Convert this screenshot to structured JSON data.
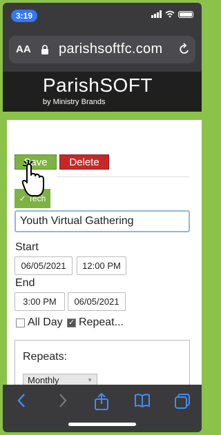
{
  "status_bar": {
    "time": "3:19"
  },
  "browser": {
    "text_size_label": "AA",
    "url": "parishsoftfc.com"
  },
  "logo": {
    "brand_name": "ParishSOFT",
    "tagline": "by Ministry Brands"
  },
  "form": {
    "save_label": "Save",
    "delete_label": "Delete",
    "tag_label": "Tech",
    "title_value": "Youth Virtual Gathering",
    "start_label": "Start",
    "start_date": "06/05/2021",
    "start_time": "12:00 PM",
    "end_label": "End",
    "end_time": "3:00 PM",
    "end_date": "06/05/2021",
    "all_day_label": "All Day",
    "repeat_label": "Repeat...",
    "repeats_label": "Repeats:",
    "repeats_value": "Monthly"
  },
  "colors": {
    "frame_green": "#8bc34a",
    "save_green": "#7cb342",
    "delete_red": "#c62828",
    "browser_bar": "#3a3a3c",
    "ios_blue": "#3f8ef7"
  }
}
